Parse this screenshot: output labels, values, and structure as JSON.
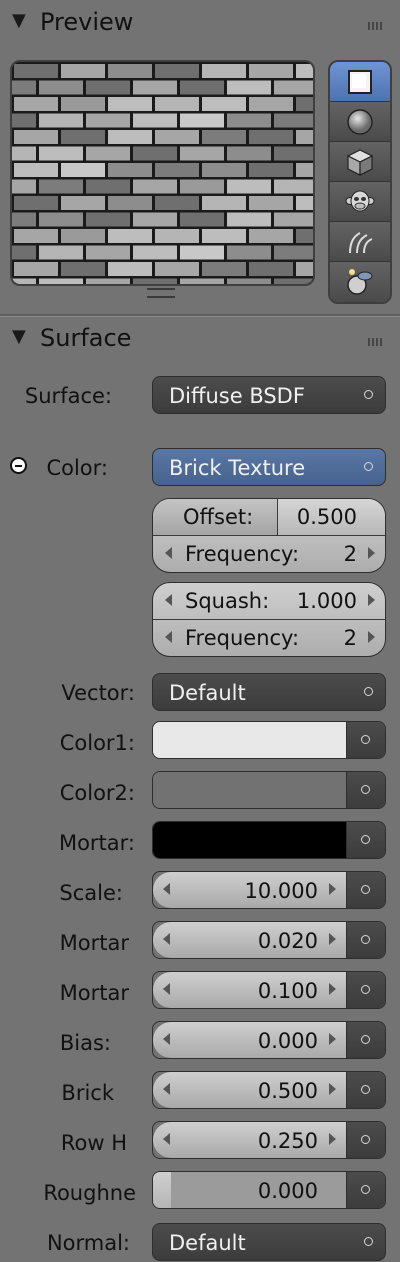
{
  "preview_panel": {
    "title": "Preview"
  },
  "preview_tools": [
    "flat-plane",
    "sphere",
    "cube",
    "monkey",
    "hair",
    "world"
  ],
  "surface_panel": {
    "title": "Surface"
  },
  "surface": {
    "label": "Surface:",
    "value": "Diffuse BSDF"
  },
  "color": {
    "label": "Color:",
    "value": "Brick Texture"
  },
  "brick_group1": {
    "offset_label": "Offset:",
    "offset_value": "0.500",
    "frequency_label": "Frequency:",
    "frequency_value": "2"
  },
  "brick_group2": {
    "squash_label": "Squash:",
    "squash_value": "1.000",
    "frequency_label": "Frequency:",
    "frequency_value": "2"
  },
  "vector": {
    "label": "Vector:",
    "value": "Default"
  },
  "color1": {
    "label": "Color1:",
    "color": "#e8e8e8"
  },
  "color2": {
    "label": "Color2:",
    "color": "#727272"
  },
  "mortar_color": {
    "label": "Mortar:",
    "color": "#000000"
  },
  "scale": {
    "label": "Scale:",
    "value": "10.000"
  },
  "mortar_size": {
    "label": "Mortar",
    "value": "0.020"
  },
  "mortar_smooth": {
    "label": "Mortar",
    "value": "0.100"
  },
  "bias": {
    "label": "Bias:",
    "value": "0.000"
  },
  "brick_width": {
    "label": "Brick",
    "value": "0.500"
  },
  "row_height": {
    "label": "Row H",
    "value": "0.250"
  },
  "roughness": {
    "label": "Roughne",
    "value": "0.000"
  },
  "normal": {
    "label": "Normal:",
    "value": "Default"
  },
  "colors": {
    "active_tool": "#5b82c4",
    "menu_blue": "#506d9a",
    "panel_bg": "#737373"
  }
}
